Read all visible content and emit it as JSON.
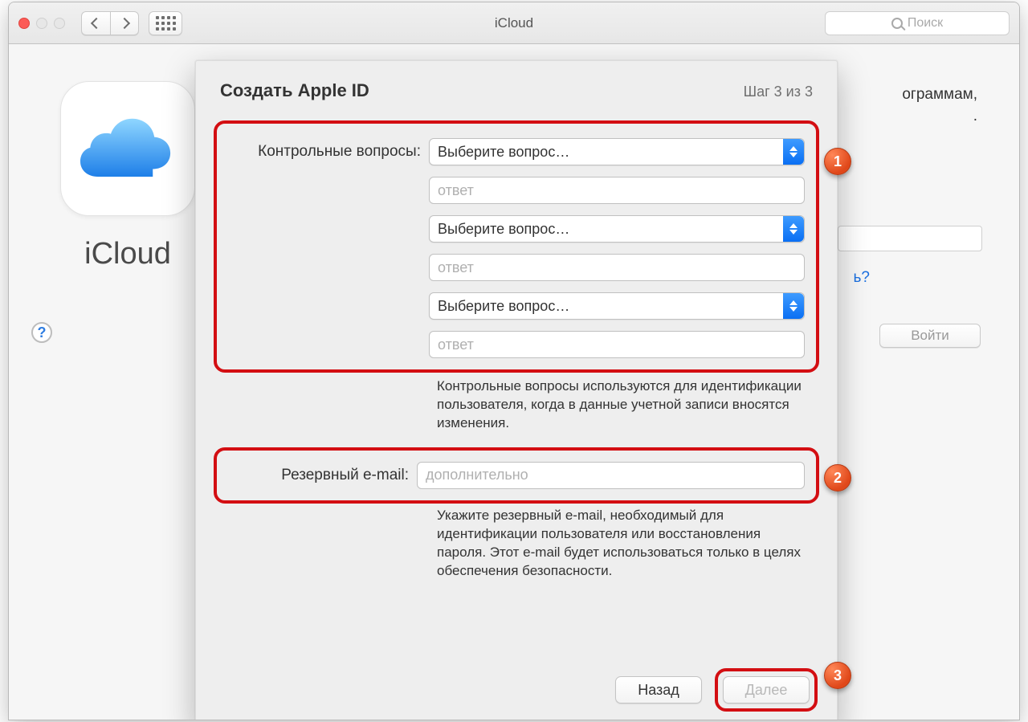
{
  "titlebar": {
    "title": "iCloud",
    "search_placeholder": "Поиск"
  },
  "sidebar": {
    "label": "iCloud",
    "help": "?"
  },
  "background": {
    "text_line1": "ограммам,",
    "text_line2": ".",
    "forgot_suffix": "ь?",
    "login_button": "Войти"
  },
  "sheet": {
    "heading": "Создать Apple ID",
    "step": "Шаг 3 из 3",
    "questions_label": "Контрольные вопросы:",
    "select_placeholder": "Выберите вопрос…",
    "answer_placeholder": "ответ",
    "questions_hint": "Контрольные вопросы используются для идентификации пользователя, когда в данные учетной записи вносятся изменения.",
    "rescue_label": "Резервный e-mail:",
    "rescue_placeholder": "дополнительно",
    "rescue_hint": "Укажите резервный e-mail, необходимый для идентификации пользователя или восстановления пароля. Этот e-mail будет использоваться только в целях обеспечения безопасности.",
    "back": "Назад",
    "next": "Далее"
  },
  "callouts": {
    "c1": "1",
    "c2": "2",
    "c3": "3"
  }
}
